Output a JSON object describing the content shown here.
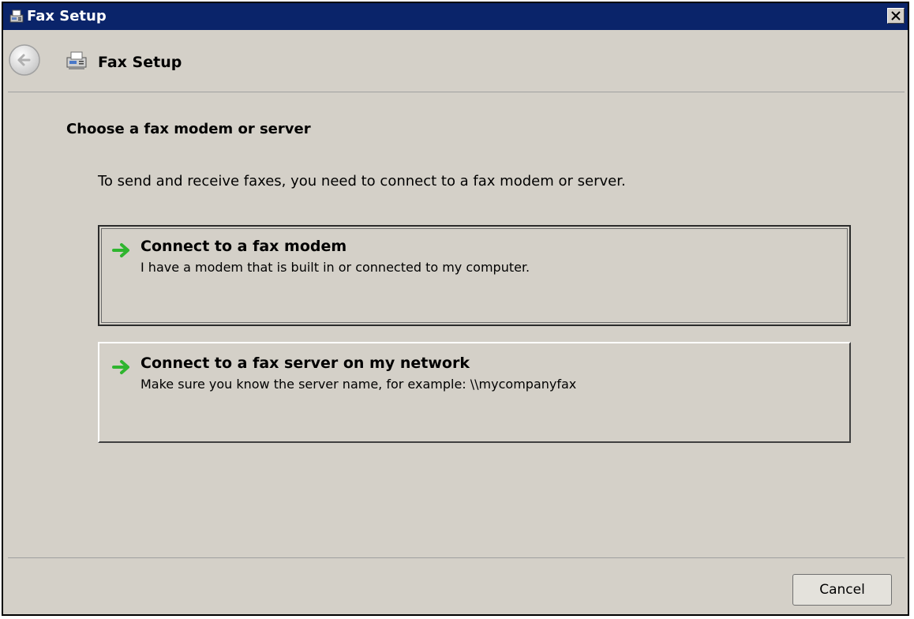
{
  "window": {
    "title": "Fax Setup",
    "titlebar_color": "#0a246a"
  },
  "nav": {
    "title": "Fax Setup",
    "back_icon": "back-arrow-icon",
    "page_icon": "fax-icon"
  },
  "content": {
    "heading": "Choose a fax modem or server",
    "description": "To send and receive faxes, you need to connect to a fax modem or server.",
    "options": [
      {
        "title": "Connect to a fax modem",
        "description": "I have a modem that is built in or connected to my computer.",
        "icon": "green-arrow-icon"
      },
      {
        "title": "Connect to a fax server on my network",
        "description": "Make sure you know the server name, for example: \\\\mycompanyfax",
        "icon": "green-arrow-icon"
      }
    ]
  },
  "footer": {
    "cancel_label": "Cancel"
  },
  "colors": {
    "background": "#d4d0c8",
    "arrow_green": "#2fb52f"
  }
}
